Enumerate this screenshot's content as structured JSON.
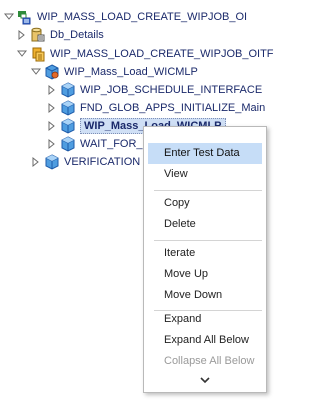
{
  "tree": {
    "root": {
      "label": "WIP_MASS_LOAD_CREATE_WIPJOB_OI",
      "icon": "test-suite-icon"
    },
    "db_details": {
      "label": "Db_Details",
      "icon": "database-icon"
    },
    "oitf": {
      "label": "WIP_MASS_LOAD_CREATE_WIPJOB_OITF",
      "icon": "test-case-icon"
    },
    "wicmlp_parent": {
      "label": "WIP_Mass_Load_WICMLP",
      "icon": "component-group-icon"
    },
    "children": [
      {
        "label": "WIP_JOB_SCHEDULE_INTERFACE",
        "icon": "component-icon"
      },
      {
        "label": "FND_GLOB_APPS_INITIALIZE_Main",
        "icon": "component-icon"
      },
      {
        "label": "WIP_Mass_Load_WICMLP",
        "icon": "component-icon"
      },
      {
        "label": "WAIT_FOR_",
        "icon": "component-icon"
      }
    ],
    "verification": {
      "label": "VERIFICATION",
      "icon": "component-icon"
    }
  },
  "context_menu": {
    "items": [
      {
        "label": "Enter Test Data",
        "state": "highlighted"
      },
      {
        "label": "View",
        "state": "normal"
      },
      {
        "label": "Copy",
        "state": "normal"
      },
      {
        "label": "Delete",
        "state": "normal"
      },
      {
        "label": "Iterate",
        "state": "normal"
      },
      {
        "label": "Move Up",
        "state": "normal"
      },
      {
        "label": "Move Down",
        "state": "normal"
      },
      {
        "label": "Expand",
        "state": "normal"
      },
      {
        "label": "Expand All Below",
        "state": "normal"
      },
      {
        "label": "Collapse All Below",
        "state": "disabled"
      }
    ],
    "scroll_icon": "chevron-down-icon"
  },
  "colors": {
    "tree_text": "#1b2a6b",
    "selection_bg": "#cfdff5",
    "menu_highlight": "#c6ddf7",
    "disabled_text": "#9a9a9a"
  }
}
